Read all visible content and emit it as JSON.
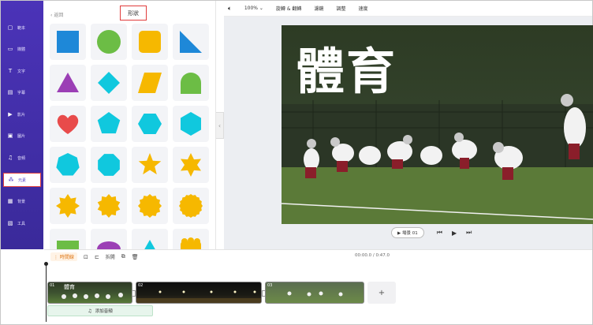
{
  "sidebar": {
    "items": [
      {
        "label": "範本",
        "icon": "template-icon"
      },
      {
        "label": "媒體",
        "icon": "media-icon"
      },
      {
        "label": "文字",
        "icon": "text-icon"
      },
      {
        "label": "字幕",
        "icon": "subtitle-icon"
      },
      {
        "label": "影片",
        "icon": "video-icon"
      },
      {
        "label": "圖片",
        "icon": "image-icon"
      },
      {
        "label": "音頻",
        "icon": "music-icon"
      },
      {
        "label": "元素",
        "icon": "elements-icon",
        "active": true
      },
      {
        "label": "背景",
        "icon": "background-icon"
      },
      {
        "label": "工具",
        "icon": "tools-icon"
      }
    ]
  },
  "panel": {
    "back_label": "返回",
    "title": "形狀",
    "shapes": [
      {
        "shape": "square",
        "color": "#1e88d8"
      },
      {
        "shape": "circle",
        "color": "#6cbd45"
      },
      {
        "shape": "rounded-square",
        "color": "#f6b800"
      },
      {
        "shape": "right-triangle",
        "color": "#1e88d8"
      },
      {
        "shape": "triangle",
        "color": "#9b3fb5"
      },
      {
        "shape": "diamond",
        "color": "#10c8de"
      },
      {
        "shape": "parallelogram",
        "color": "#f6b800"
      },
      {
        "shape": "arch",
        "color": "#6cbd45"
      },
      {
        "shape": "heart",
        "color": "#e84b4b"
      },
      {
        "shape": "pentagon",
        "color": "#10c8de"
      },
      {
        "shape": "hexagon",
        "color": "#10c8de"
      },
      {
        "shape": "hexagon-vertical",
        "color": "#10c8de"
      },
      {
        "shape": "heptagon",
        "color": "#10c8de"
      },
      {
        "shape": "octagon",
        "color": "#10c8de"
      },
      {
        "shape": "star5",
        "color": "#f6b800"
      },
      {
        "shape": "star6",
        "color": "#f6b800"
      },
      {
        "shape": "burst8",
        "color": "#f6b800"
      },
      {
        "shape": "burst10",
        "color": "#f6b800"
      },
      {
        "shape": "burst12",
        "color": "#f6b800"
      },
      {
        "shape": "burst16",
        "color": "#f6b800"
      },
      {
        "shape": "green-rect",
        "color": "#6cbd45"
      },
      {
        "shape": "ellipse",
        "color": "#9b3fb5"
      },
      {
        "shape": "small-triangle",
        "color": "#10c8de"
      },
      {
        "shape": "scalloped",
        "color": "#f6b800"
      }
    ]
  },
  "toolbar": {
    "volume_icon": "speaker-icon",
    "zoom": "100%",
    "flip_label": "旋轉 & 翻轉",
    "filter_label": "濾鏡",
    "adjust_label": "調整",
    "speed_label": "速度"
  },
  "preview": {
    "title_text": "體育",
    "scene_label": "▶ 場景 01"
  },
  "timeline": {
    "timeline_label": "時間線",
    "time": "00:00.0 / 0:47.0",
    "split_label": "拆開",
    "clips": [
      {
        "num": "01",
        "mini_title": "體育"
      },
      {
        "num": "02",
        "mini_title": ""
      },
      {
        "num": "03",
        "mini_title": ""
      }
    ],
    "add_label": "+",
    "audio_label": "添加音頻"
  },
  "colors": {
    "sidebar": "#3f2fa8",
    "highlight": "#e03c3c",
    "accent": "#e07a1a"
  }
}
